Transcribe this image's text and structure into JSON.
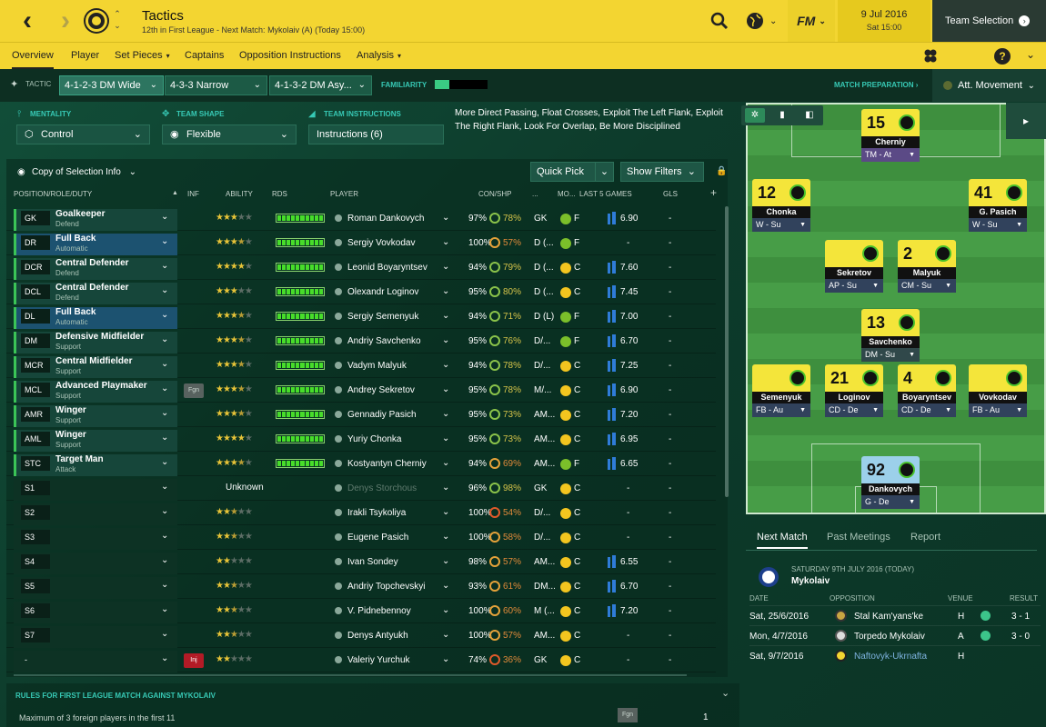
{
  "header": {
    "title": "Tactics",
    "subtitle": "12th in First League - Next Match: Mykolaiv (A) (Today 15:00)",
    "date": "9 Jul 2016",
    "time": "Sat 15:00",
    "fm_logo": "FM",
    "team_selection": "Team Selection",
    "club_badge_icon": "club-badge-icon"
  },
  "nav": {
    "items": [
      "Overview",
      "Player",
      "Set Pieces",
      "Captains",
      "Opposition Instructions",
      "Analysis"
    ],
    "active": "Overview",
    "help": "?"
  },
  "tactics": {
    "label": "TACTIC",
    "tabs": [
      "4-1-2-3 DM Wide",
      "4-3-3 Narrow",
      "4-1-3-2 DM Asy..."
    ],
    "active_tab": 0,
    "familiarity_label": "FAMILIARITY",
    "familiarity_level": 0.28,
    "match_preparation": "MATCH PREPARATION",
    "att_movement": "Att. Movement"
  },
  "settings": {
    "mentality_label": "MENTALITY",
    "mentality_value": "Control",
    "shape_label": "TEAM SHAPE",
    "shape_value": "Flexible",
    "instructions_label": "TEAM INSTRUCTIONS",
    "instructions_value": "Instructions (6)",
    "instructions_text": "More Direct Passing, Float Crosses, Exploit The Left Flank, Exploit The Right Flank, Look For Overlap, Be More Disciplined"
  },
  "squad": {
    "view_label": "Copy of Selection Info",
    "quick_pick": "Quick Pick",
    "show_filters": "Show Filters",
    "columns": {
      "position": "POSITION/ROLE/DUTY",
      "inf": "INF",
      "ability": "ABILITY",
      "rds": "RDS",
      "player": "PLAYER",
      "con_shp": "CON/SHP",
      "dots": "...",
      "mo": "MO...",
      "last5": "LAST 5 GAMES",
      "gls": "GLS"
    },
    "rows": [
      {
        "pos": "GK",
        "role": "Goalkeeper",
        "duty": "Defend",
        "inf": "",
        "stars": 3.0,
        "name": "Roman Dankovych",
        "con": "97%",
        "shp": "78%",
        "posabbr": "GK",
        "mo": "F",
        "form": "6.90",
        "gls": "-"
      },
      {
        "pos": "DR",
        "role": "Full Back",
        "duty": "Automatic",
        "inf": "",
        "stars": 3.5,
        "name": "Sergiy Vovkodav",
        "con": "100%",
        "shp": "57%",
        "posabbr": "D (...",
        "mo": "F",
        "form": "-",
        "gls": "-"
      },
      {
        "pos": "DCR",
        "role": "Central Defender",
        "duty": "Defend",
        "inf": "",
        "stars": 4.0,
        "name": "Leonid Boyaryntsev",
        "con": "94%",
        "shp": "79%",
        "posabbr": "D (...",
        "mo": "C",
        "form": "7.60",
        "gls": "-"
      },
      {
        "pos": "DCL",
        "role": "Central Defender",
        "duty": "Defend",
        "inf": "",
        "stars": 3.0,
        "name": "Olexandr Loginov",
        "con": "95%",
        "shp": "80%",
        "posabbr": "D (...",
        "mo": "C",
        "form": "7.45",
        "gls": "-"
      },
      {
        "pos": "DL",
        "role": "Full Back",
        "duty": "Automatic",
        "inf": "",
        "stars": 3.5,
        "name": "Sergiy Semenyuk",
        "con": "94%",
        "shp": "71%",
        "posabbr": "D (L)",
        "mo": "F",
        "form": "7.00",
        "gls": "-"
      },
      {
        "pos": "DM",
        "role": "Defensive Midfielder",
        "duty": "Support",
        "inf": "",
        "stars": 3.5,
        "name": "Andriy Savchenko",
        "con": "95%",
        "shp": "76%",
        "posabbr": "D/...",
        "mo": "F",
        "form": "6.70",
        "gls": "-"
      },
      {
        "pos": "MCR",
        "role": "Central Midfielder",
        "duty": "Support",
        "inf": "",
        "stars": 3.5,
        "name": "Vadym Malyuk",
        "con": "94%",
        "shp": "78%",
        "posabbr": "D/...",
        "mo": "C",
        "form": "7.25",
        "gls": "-"
      },
      {
        "pos": "MCL",
        "role": "Advanced Playmaker",
        "duty": "Support",
        "inf": "Fgn",
        "stars": 3.5,
        "name": "Andrey Sekretov",
        "con": "95%",
        "shp": "78%",
        "posabbr": "M/...",
        "mo": "C",
        "form": "6.90",
        "gls": "-"
      },
      {
        "pos": "AMR",
        "role": "Winger",
        "duty": "Support",
        "inf": "",
        "stars": 3.5,
        "name": "Gennadiy Pasich",
        "con": "95%",
        "shp": "73%",
        "posabbr": "AM...",
        "mo": "C",
        "form": "7.20",
        "gls": "-"
      },
      {
        "pos": "AML",
        "role": "Winger",
        "duty": "Support",
        "inf": "",
        "stars": 4.0,
        "name": "Yuriy Chonka",
        "con": "95%",
        "shp": "73%",
        "posabbr": "AM...",
        "mo": "C",
        "form": "6.95",
        "gls": "-"
      },
      {
        "pos": "STC",
        "role": "Target Man",
        "duty": "Attack",
        "inf": "",
        "stars": 3.5,
        "name": "Kostyantyn Cherniy",
        "con": "94%",
        "shp": "69%",
        "posabbr": "AM...",
        "mo": "F",
        "form": "6.65",
        "gls": "-"
      },
      {
        "pos": "S1",
        "role": "",
        "duty": "",
        "inf": "",
        "stars": -1,
        "ability_text": "Unknown",
        "name": "Denys Storchous",
        "con": "96%",
        "shp": "98%",
        "posabbr": "GK",
        "mo": "C",
        "form": "-",
        "gls": "-"
      },
      {
        "pos": "S2",
        "role": "",
        "duty": "",
        "inf": "",
        "stars": 2.5,
        "name": "Irakli Tsykoliya",
        "con": "100%",
        "shp": "54%",
        "posabbr": "D/...",
        "mo": "C",
        "form": "-",
        "gls": "-"
      },
      {
        "pos": "S3",
        "role": "",
        "duty": "",
        "inf": "",
        "stars": 2.5,
        "name": "Eugene Pasich",
        "con": "100%",
        "shp": "58%",
        "posabbr": "D/...",
        "mo": "C",
        "form": "-",
        "gls": "-"
      },
      {
        "pos": "S4",
        "role": "",
        "duty": "",
        "inf": "",
        "stars": 2.0,
        "name": "Ivan Sondey",
        "con": "98%",
        "shp": "57%",
        "posabbr": "AM...",
        "mo": "C",
        "form": "6.55",
        "gls": "-"
      },
      {
        "pos": "S5",
        "role": "",
        "duty": "",
        "inf": "",
        "stars": 2.5,
        "name": "Andriy Topchevskyi",
        "con": "93%",
        "shp": "61%",
        "posabbr": "DM...",
        "mo": "C",
        "form": "6.70",
        "gls": "-"
      },
      {
        "pos": "S6",
        "role": "",
        "duty": "",
        "inf": "",
        "stars": 2.5,
        "name": "V. Pidnebennoy",
        "con": "100%",
        "shp": "60%",
        "posabbr": "M (...",
        "mo": "C",
        "form": "7.20",
        "gls": "-"
      },
      {
        "pos": "S7",
        "role": "",
        "duty": "",
        "inf": "",
        "stars": 2.5,
        "name": "Denys Antyukh",
        "con": "100%",
        "shp": "57%",
        "posabbr": "AM...",
        "mo": "C",
        "form": "-",
        "gls": "-"
      },
      {
        "pos": "-",
        "role": "",
        "duty": "",
        "inf": "Inj",
        "stars": 2.0,
        "name": "Valeriy Yurchuk",
        "con": "74%",
        "shp": "36%",
        "posabbr": "GK",
        "mo": "C",
        "form": "-",
        "gls": "-"
      }
    ]
  },
  "rules": {
    "title": "RULES FOR FIRST LEAGUE MATCH AGAINST MYKOLAIV",
    "rule": "Maximum of 3 foreign players in the first 11",
    "badge": "Fgn",
    "value": "1"
  },
  "pitch": {
    "players": [
      {
        "num": "15",
        "name": "Cherniy",
        "role": "TM - At"
      },
      {
        "num": "12",
        "name": "Chonka",
        "role": "W - Su"
      },
      {
        "num": "41",
        "name": "G. Pasich",
        "role": "W - Su"
      },
      {
        "num": "",
        "name": "Sekretov",
        "role": "AP - Su"
      },
      {
        "num": "2",
        "name": "Malyuk",
        "role": "CM - Su"
      },
      {
        "num": "13",
        "name": "Savchenko",
        "role": "DM - Su"
      },
      {
        "num": "",
        "name": "Semenyuk",
        "role": "FB - Au"
      },
      {
        "num": "21",
        "name": "Loginov",
        "role": "CD - De"
      },
      {
        "num": "4",
        "name": "Boyaryntsev",
        "role": "CD - De"
      },
      {
        "num": "",
        "name": "Vovkodav",
        "role": "FB - Au"
      },
      {
        "num": "92",
        "name": "Dankovych",
        "role": "G - De"
      }
    ]
  },
  "next_match": {
    "tabs": [
      "Next Match",
      "Past Meetings",
      "Report"
    ],
    "active_tab": "Next Match",
    "date": "SATURDAY 9TH JULY 2016 (TODAY)",
    "opponent": "Mykolaiv",
    "headers": {
      "date": "DATE",
      "opposition": "OPPOSITION",
      "venue": "VENUE",
      "result": "RESULT"
    },
    "results": [
      {
        "date": "Sat, 25/6/2016",
        "opp": "Stal Kam'yans'ke",
        "venue": "H",
        "result": "3 - 1",
        "won": true
      },
      {
        "date": "Mon, 4/7/2016",
        "opp": "Torpedo Mykolaiv",
        "venue": "A",
        "result": "3 - 0",
        "won": true
      },
      {
        "date": "Sat, 9/7/2016",
        "opp": "Naftovyk-Ukrnafta",
        "venue": "H",
        "result": "",
        "won": false
      }
    ]
  },
  "colors": {
    "accent": "#f3d531",
    "teal": "#37c9b5",
    "green": "#47dd2a",
    "bg": "#0f3d2c"
  }
}
